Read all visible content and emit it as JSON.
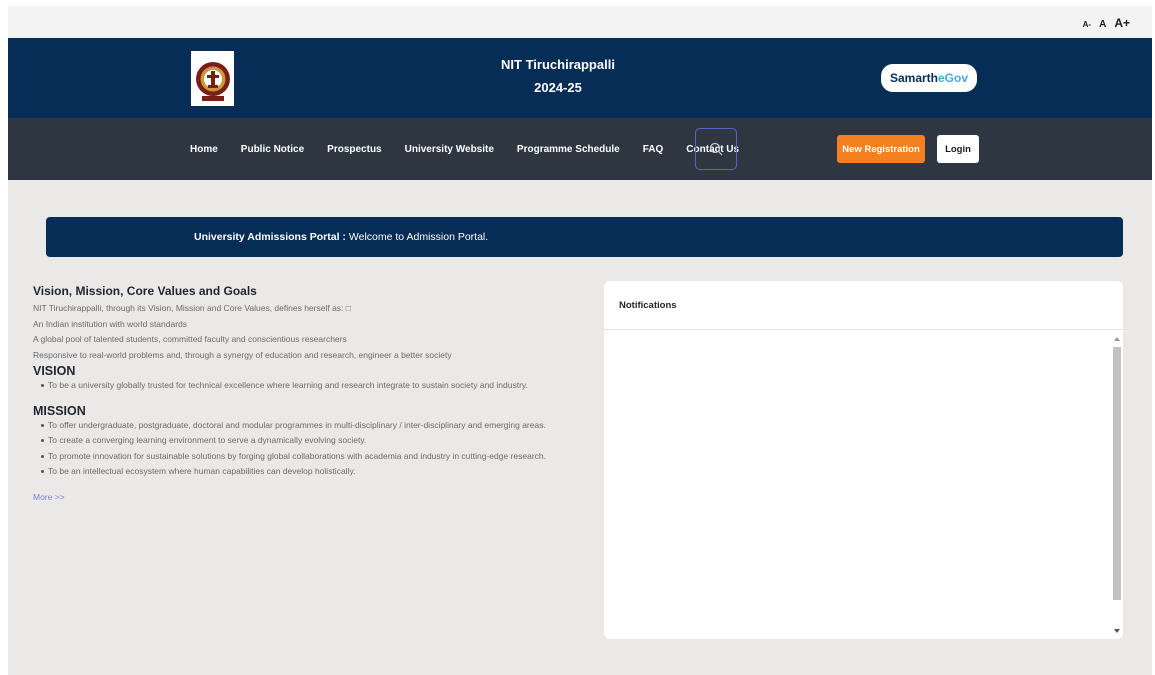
{
  "font_controls": {
    "small": "A-",
    "normal": "A",
    "large": "A+"
  },
  "header": {
    "institution": "NIT Tiruchirappalli",
    "year": "2024-25",
    "badge_main": "Samarth",
    "badge_accent": "eGov"
  },
  "nav": {
    "items": [
      {
        "label": "Home"
      },
      {
        "label": "Public Notice"
      },
      {
        "label": "Prospectus"
      },
      {
        "label": "University Website"
      },
      {
        "label": "Programme Schedule"
      },
      {
        "label": "FAQ"
      },
      {
        "label": "Contact Us"
      }
    ],
    "search_icon": "search-icon",
    "register_label": "New Registration",
    "login_label": "Login"
  },
  "banner": {
    "title": "University Admissions Portal :",
    "message": "Welcome to Admission Portal."
  },
  "about": {
    "title": "Vision, Mission, Core Values and Goals",
    "intro": "NIT Tiruchirappalli, through its Vision, Mission and Core Values, defines herself as: □",
    "points": [
      "An Indian institution with world standards",
      "A global pool of talented students, committed faculty and conscientious researchers",
      "Responsive to real-world problems and, through a synergy of education and research, engineer a better society"
    ],
    "vision_heading": "VISION",
    "vision_items": [
      "To be a university globally trusted for technical excellence where learning and research integrate to sustain society and industry."
    ],
    "mission_heading": "MISSION",
    "mission_items": [
      "To offer undergraduate, postgraduate, doctoral and modular programmes in multi-disciplinary / inter-disciplinary and emerging areas.",
      "To create a converging learning environment to serve a dynamically evolving society.",
      "To promote innovation for sustainable solutions by forging global collaborations with academia and industry in cutting-edge research.",
      "To be an intellectual ecosystem where human capabilities can develop holistically."
    ],
    "more_label": "More >>"
  },
  "notifications": {
    "title": "Notifications"
  },
  "colors": {
    "header_bg": "#062d55",
    "nav_bg": "#2d3641",
    "page_bg": "#ebe9e7",
    "register_btn": "#f4801f",
    "link": "#7a7ee0"
  }
}
